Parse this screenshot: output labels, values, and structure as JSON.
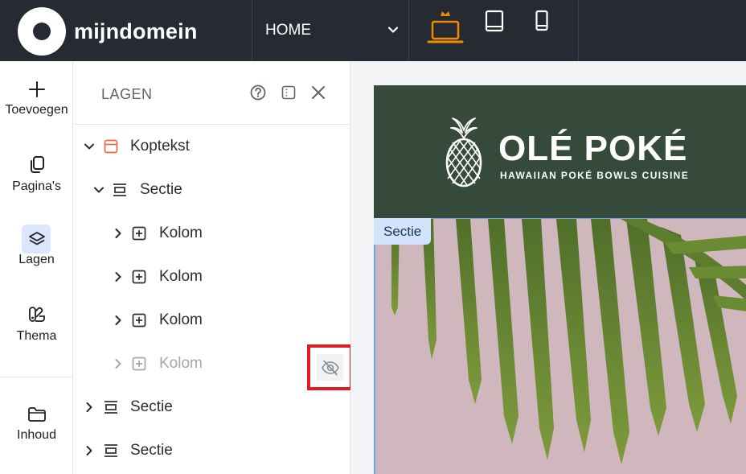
{
  "app": {
    "brand_name": "mijndomein",
    "page_select": {
      "value": "HOME"
    },
    "devices": [
      {
        "name": "desktop",
        "active": true,
        "accent": "#f08a00"
      },
      {
        "name": "tablet",
        "active": false
      },
      {
        "name": "mobile",
        "active": false
      }
    ]
  },
  "rail": {
    "items": [
      {
        "label": "Toevoegen",
        "icon": "plus-icon"
      },
      {
        "label": "Pagina's",
        "icon": "pages-icon"
      },
      {
        "label": "Lagen",
        "icon": "layers-icon",
        "active": true
      },
      {
        "label": "Thema",
        "icon": "theme-icon"
      },
      {
        "label": "Inhoud",
        "icon": "folder-icon"
      }
    ]
  },
  "panel": {
    "title": "LAGEN",
    "tools": [
      "help-icon",
      "dock-icon",
      "close-icon"
    ],
    "tree": [
      {
        "label": "Koptekst",
        "icon": "header-icon",
        "expanded": true
      },
      {
        "label": "Sectie",
        "icon": "section-icon",
        "expanded": true
      },
      {
        "label": "Kolom",
        "icon": "column-icon",
        "expanded": false
      },
      {
        "label": "Kolom",
        "icon": "column-icon",
        "expanded": false
      },
      {
        "label": "Kolom",
        "icon": "column-icon",
        "expanded": false
      },
      {
        "label": "Kolom",
        "icon": "column-icon",
        "expanded": false,
        "hidden": true
      },
      {
        "label": "Sectie",
        "icon": "section-icon",
        "expanded": false
      },
      {
        "label": "Sectie",
        "icon": "section-icon",
        "expanded": false
      }
    ]
  },
  "canvas": {
    "site_title": "OLÉ POKÉ",
    "site_tagline": "HAWAIIAN POKÉ BOWLS CUISINE",
    "section_tag": "Sectie",
    "colors": {
      "header_bg": "#354a3a",
      "hero_bg": "#d0b7bd",
      "selection": "#6da1f2"
    }
  }
}
